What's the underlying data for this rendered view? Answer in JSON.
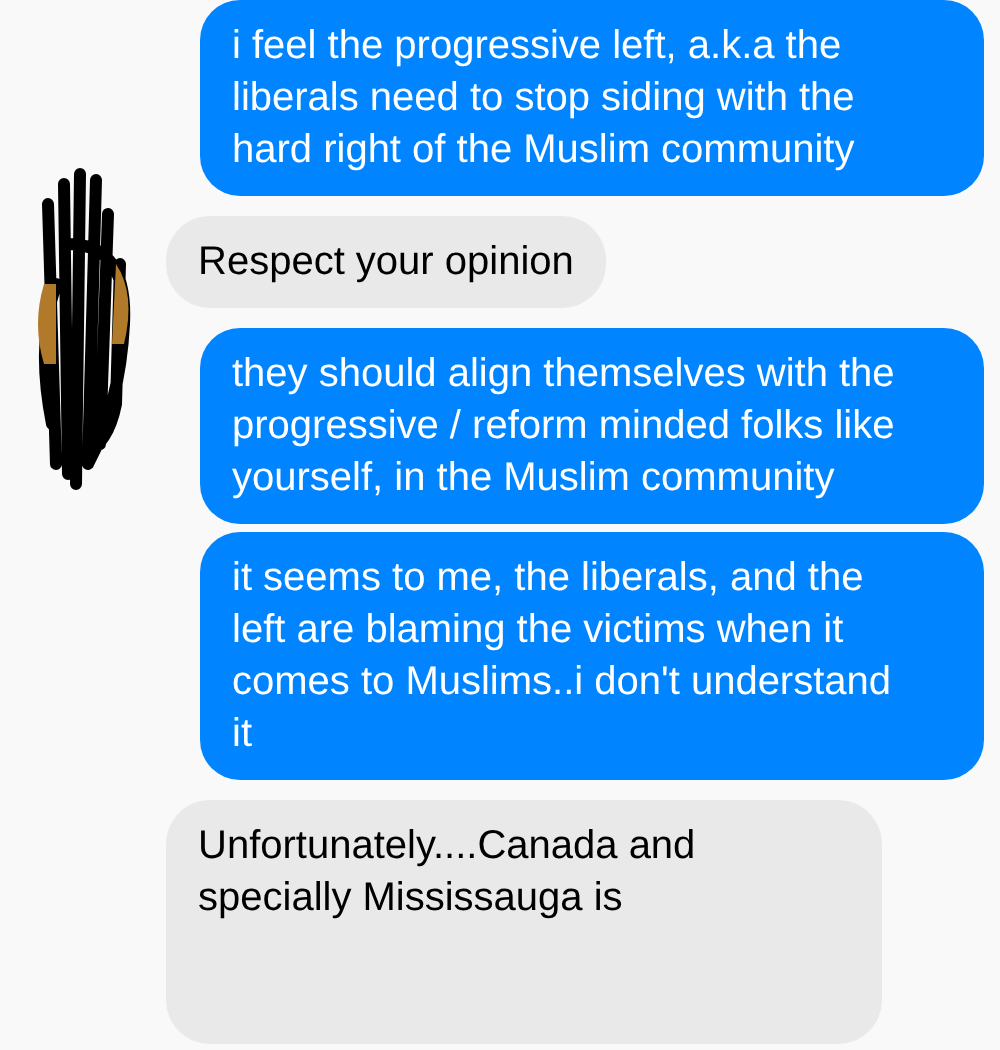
{
  "messages": [
    {
      "kind": "outgoing",
      "text": "i feel the progressive left, a.k.a the liberals need to stop siding with the hard right of the Muslim community"
    },
    {
      "kind": "incoming",
      "text": "Respect your opinion"
    },
    {
      "kind": "outgoing",
      "text": "they should align themselves with the progressive / reform minded folks like yourself, in the Muslim community"
    },
    {
      "kind": "outgoing",
      "text": "it seems to me, the liberals, and the left are blaming the victims when it comes to Muslims..i don't understand it"
    },
    {
      "kind": "incoming",
      "text": "Unfortunately....Canada and specially Mississauga is"
    }
  ]
}
